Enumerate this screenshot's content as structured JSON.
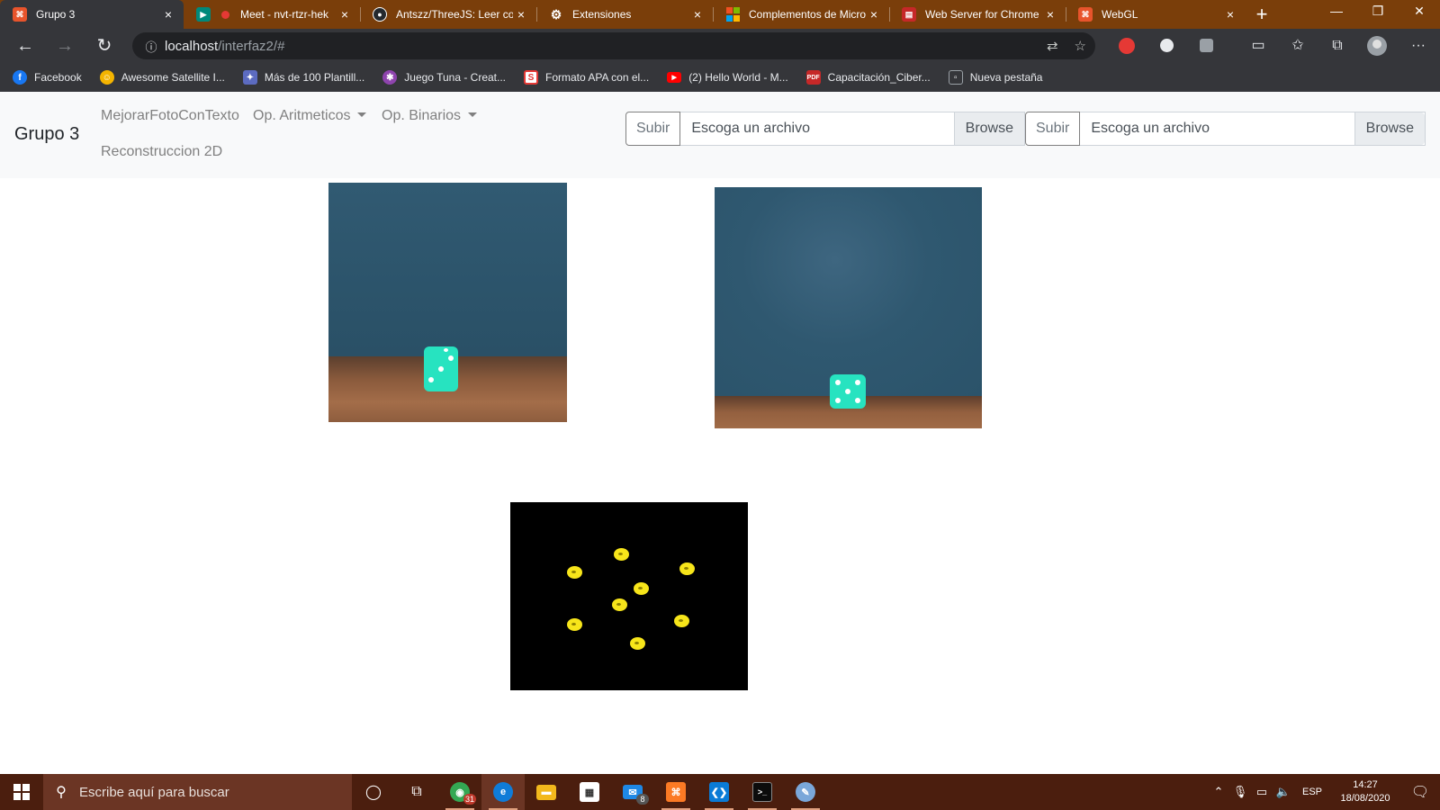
{
  "browser": {
    "tabs": [
      {
        "title": "Grupo 3",
        "favicon_color": "#e8542c",
        "active": true
      },
      {
        "title": "Meet - nvt-rtzr-hek",
        "favicon_color": "#00897b",
        "recording": true
      },
      {
        "title": "Antszz/ThreeJS: Leer coo",
        "favicon_color": "#24292e"
      },
      {
        "title": "Extensiones",
        "favicon_color": "#7a3e0a"
      },
      {
        "title": "Complementos de Micro",
        "favicon_color": "#f25022"
      },
      {
        "title": "Web Server for Chrome",
        "favicon_color": "#c62828"
      },
      {
        "title": "WebGL",
        "favicon_color": "#e8542c"
      }
    ],
    "tab_close_glyph": "×",
    "new_tab_glyph": "+",
    "window_controls": [
      "—",
      "❐",
      "✕"
    ],
    "address": {
      "host": "localhost",
      "path": "/interfaz2/#"
    },
    "bookmarks": [
      {
        "label": "Facebook",
        "color": "#1877f2"
      },
      {
        "label": "Awesome Satellite I...",
        "color": "#f4b400"
      },
      {
        "label": "Más de 100 Plantill...",
        "color": "#5c6bc0"
      },
      {
        "label": "Juego Tuna - Creat...",
        "color": "#8e44ad"
      },
      {
        "label": "Formato APA con el...",
        "color": "#e53935"
      },
      {
        "label": "(2) Hello World - M...",
        "color": "#ff0000"
      },
      {
        "label": "Capacitación_Ciber...",
        "color": "#c62828"
      },
      {
        "label": "Nueva pestaña",
        "color": "#9aa0a6"
      }
    ]
  },
  "app": {
    "brand": "Grupo 3",
    "nav": {
      "mejorar": "MejorarFotoConTexto",
      "aritmeticos": "Op. Aritmeticos",
      "binarios": "Op. Binarios",
      "reconstruccion": "Reconstruccion 2D"
    },
    "uploads": [
      {
        "prepend": "Subir",
        "placeholder": "Escoga un archivo",
        "browse": "Browse"
      },
      {
        "prepend": "Subir",
        "placeholder": "Escoga un archivo",
        "browse": "Browse"
      }
    ],
    "images": {
      "left_photo_pips": 3,
      "right_photo_pips": 5,
      "result_blobs": 8
    }
  },
  "taskbar": {
    "search_placeholder": "Escribe aquí para buscar",
    "apps": [
      {
        "name": "chrome",
        "color": "#34a853",
        "badge": "31",
        "running": true
      },
      {
        "name": "edge",
        "color": "#0f7cd8",
        "active": true,
        "running": true
      },
      {
        "name": "file-explorer",
        "color": "#f2b81c"
      },
      {
        "name": "store",
        "color": "#ffffff"
      },
      {
        "name": "mail",
        "color": "#1e88e5",
        "badge": "8"
      },
      {
        "name": "xampp",
        "color": "#fb7a24",
        "running": true
      },
      {
        "name": "vscode",
        "color": "#0a7bd6",
        "running": true
      },
      {
        "name": "terminal",
        "color": "#0c0c0c",
        "running": true
      },
      {
        "name": "paint",
        "color": "#7aa7d9",
        "running": true
      }
    ],
    "language": "ESP",
    "time": "14:27",
    "date": "18/08/2020"
  }
}
